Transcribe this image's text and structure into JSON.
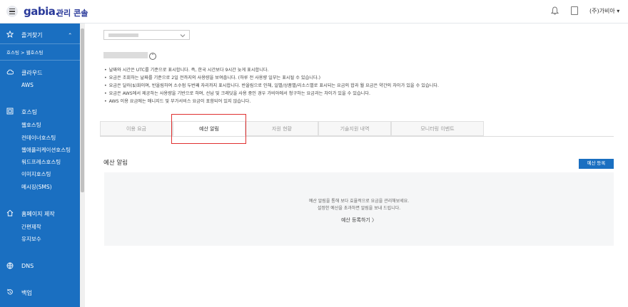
{
  "header": {
    "logo": "gabia.",
    "logo_sub": "관리 콘솔",
    "user": "(주)가비아 ▾"
  },
  "sidebar": {
    "favorites": "즐겨찾기",
    "favorites_chevron": "⌃",
    "favorite_path": "호스팅 > 웹호스팅",
    "cloud": "클라우드",
    "cloud_items": [
      "AWS"
    ],
    "hosting": "호스팅",
    "hosting_items": [
      "웹호스팅",
      "컨테이너호스팅",
      "웹애플리케이션호스팅",
      "워드프레스호스팅",
      "이미지호스팅",
      "메시징(SMS)"
    ],
    "homepage": "홈페이지 제작",
    "homepage_items": [
      "간편제작",
      "유지보수"
    ],
    "dns": "DNS",
    "backup": "백업"
  },
  "notes": [
    "날짜와 시간은 UTC를 기준으로 표시합니다. 즉, 한국 시간보다 9시간 늦게 표시합니다.",
    "요금은 조회하는 날짜를 기준으로 2일 전까지의 사용량을 보여줍니다. (하루 전 사용량 일부는 표시될 수 있습니다.)",
    "요금은 달러($)화이며, 반올림하여 소수점 두번째 자리까지 표시합니다. 반올림으로 인해, 일별/상품별/리소스별로 표시되는 요금의 합과 월 요금은 약간의 차이가 있을 수 있습니다.",
    "요금은 AWS에서 제공하는 사용량을 기반으로 하며, 선납 및 크레딧을 사용 중인 경우 가비아에서 청구하는 요금과는 차이가 있을 수 있습니다.",
    "AWS 이용 요금에는 매니지드 및 부가서비스 요금이 포함되어 있지 않습니다."
  ],
  "tabs": [
    "이용 요금",
    "예산 알림",
    "자원 현황",
    "기술지원 내역",
    "모니터링 이벤트"
  ],
  "section": {
    "title": "예산 알림",
    "register_button": "예산 등록",
    "empty_line1": "예산 알림을 통해 보다 효율적으로 요금을 관리해보세요.",
    "empty_line2": "설정한 예산을 초과하면 알림을 보내 드립니다.",
    "empty_link": "예산 등록하기 〉"
  }
}
